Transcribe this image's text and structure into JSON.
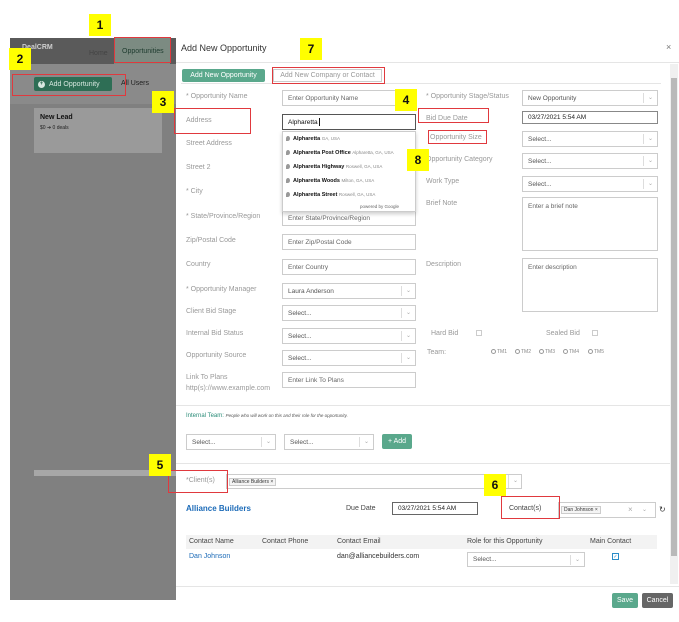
{
  "background_app": {
    "brand": "DealCRM",
    "tab_home": "Home",
    "tab_opportunities": "Opportunities",
    "add_opportunity": "Add Opportunity",
    "all_users": "All Users",
    "lane_title": "New Lead",
    "lane_sub": "$0 ➔ 0 deals"
  },
  "modal": {
    "title": "Add New Opportunity",
    "close": "×",
    "tab_new_opportunity": "Add New Opportunity",
    "tab_new_company": "Add New Company or Contact"
  },
  "left_fields": {
    "opportunity_name_label": "* Opportunity Name",
    "opportunity_name_placeholder": "Enter Opportunity Name",
    "address_label": "Address",
    "address_value": "Alpharetta",
    "street_address_label": "Street Address",
    "street2_label": "Street 2",
    "city_label": "* City",
    "state_label": "* State/Province/Region",
    "state_placeholder": "Enter State/Province/Region",
    "zip_label": "Zip/Postal Code",
    "zip_placeholder": "Enter Zip/Postal Code",
    "country_label": "Country",
    "country_placeholder": "Enter Country",
    "manager_label": "* Opportunity Manager",
    "manager_value": "Laura Anderson",
    "client_bid_stage_label": "Client Bid Stage",
    "internal_bid_status_label": "Internal Bid Status",
    "opportunity_source_label": "Opportunity Source",
    "link_label_1": "Link To Plans",
    "link_label_2": "http(s)://www.example.com",
    "link_placeholder": "Enter Link To Plans",
    "select_placeholder": "Select..."
  },
  "address_suggestions": [
    {
      "main": "Alpharetta",
      "sub": "GA, USA"
    },
    {
      "main": "Alpharetta Post Office",
      "sub": "Alpharetta, GA, USA"
    },
    {
      "main": "Alpharetta Highway",
      "sub": "Roswell, GA, USA"
    },
    {
      "main": "Alpharetta Woods",
      "sub": "Milton, GA, USA"
    },
    {
      "main": "Alpharetta Street",
      "sub": "Roswell, GA, USA"
    }
  ],
  "powered_by": "powered by Google",
  "right_fields": {
    "stage_label": "* Opportunity Stage/Status",
    "stage_value": "New Opportunity",
    "bid_due_date_label": "Bid Due Date",
    "bid_due_date_value": "03/27/2021 5:54 AM",
    "size_label": "Opportunity Size",
    "category_label": "Opportunity Category",
    "work_type_label": "Work Type",
    "brief_note_label": "Brief Note",
    "brief_note_placeholder": "Enter a brief note",
    "description_label": "Description",
    "description_placeholder": "Enter description",
    "hard_bid_label": "Hard Bid",
    "sealed_bid_label": "Sealed Bid",
    "team_label": "Team:",
    "team_options": [
      "TM1",
      "TM2",
      "TM3",
      "TM4",
      "TM5"
    ],
    "select_placeholder": "Select..."
  },
  "internal_team": {
    "title": "Internal Team:",
    "hint": "People who will work on this and their role for the opportunity.",
    "select_placeholder": "Select...",
    "add_button": "+ Add"
  },
  "clients": {
    "label": "*Client(s)",
    "tag": "Alliance Builders",
    "tag_remove": "×",
    "company_link": "Alliance Builders",
    "due_date_label": "Due Date",
    "due_date_value": "03/27/2021 5:54 AM",
    "contacts_label": "Contact(s)",
    "contact_tag": "Dan Johnson",
    "clear": "×",
    "refresh": "↻"
  },
  "contacts_table": {
    "headers": [
      "Contact Name",
      "Contact Phone",
      "Contact Email",
      "Role for this Opportunity",
      "Main Contact"
    ],
    "rows": [
      {
        "name": "Dan Johnson",
        "phone": "",
        "email": "dan@alliancebuilders.com",
        "role": "Select...",
        "main": "✓"
      }
    ]
  },
  "footer": {
    "save": "Save",
    "cancel": "Cancel"
  },
  "annotations": [
    "1",
    "2",
    "3",
    "4",
    "5",
    "6",
    "7",
    "8"
  ],
  "colors": {
    "primary_green": "#5aa88c",
    "link_blue": "#1c6bb8",
    "annotation_yellow": "#ffff00",
    "annotation_red": "#e0393e"
  }
}
